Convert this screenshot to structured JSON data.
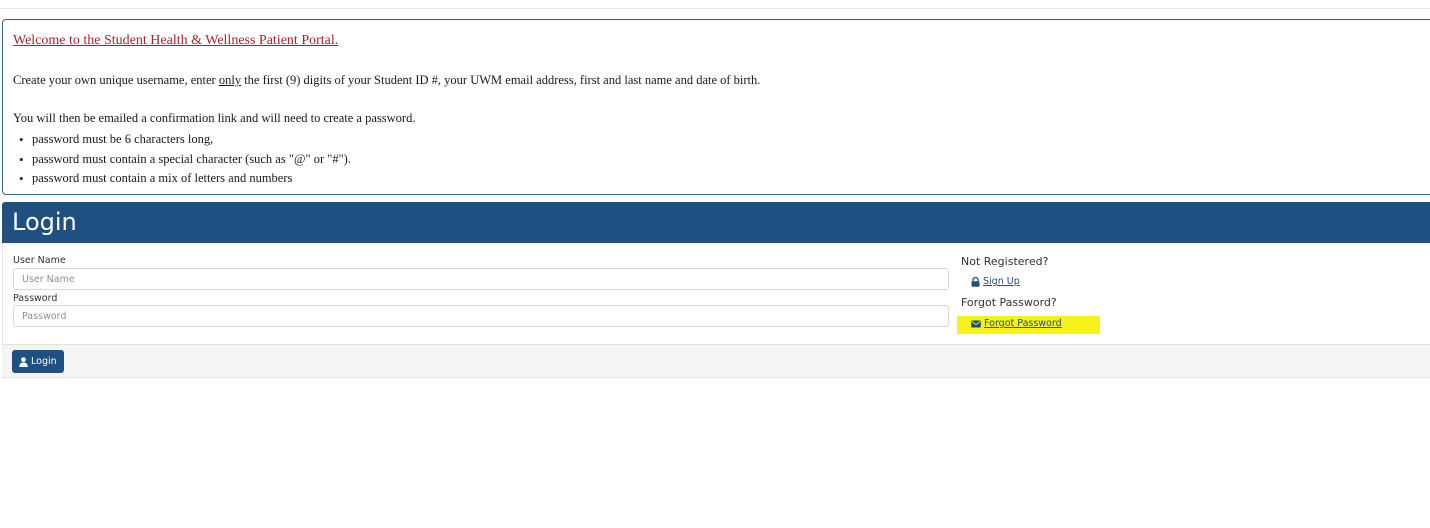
{
  "notice": {
    "title": "Welcome to the Student Health & Wellness Patient Portal.",
    "instruction_before": "Create your own unique username, enter ",
    "instruction_emphasis": "only",
    "instruction_after": " the first (9) digits of your Student ID #, your UWM email address, first and last name and date of birth.",
    "emailed_text": "You will then be emailed a confirmation link and will need to create a password.",
    "requirements": [
      "password must be 6 characters long,",
      "password must contain a special character (such as \"@\" or \"#\").",
      "password must contain a mix of letters and numbers"
    ]
  },
  "login": {
    "title": "Login",
    "username_label": "User Name",
    "username_placeholder": "User Name",
    "username_value": "",
    "password_label": "Password",
    "password_placeholder": "Password",
    "password_value": "",
    "button_label": "Login",
    "button_icon": "user-icon"
  },
  "side": {
    "not_registered_heading": "Not Registered?",
    "sign_up_label": "Sign Up",
    "sign_up_icon": "lock-icon",
    "forgot_heading": "Forgot Password?",
    "forgot_label": "Forgot Password",
    "forgot_icon": "envelope-icon",
    "highlight_color": "#f7f21a"
  },
  "colors": {
    "brand": "#1e5182",
    "welcome_link": "#a8232a"
  }
}
